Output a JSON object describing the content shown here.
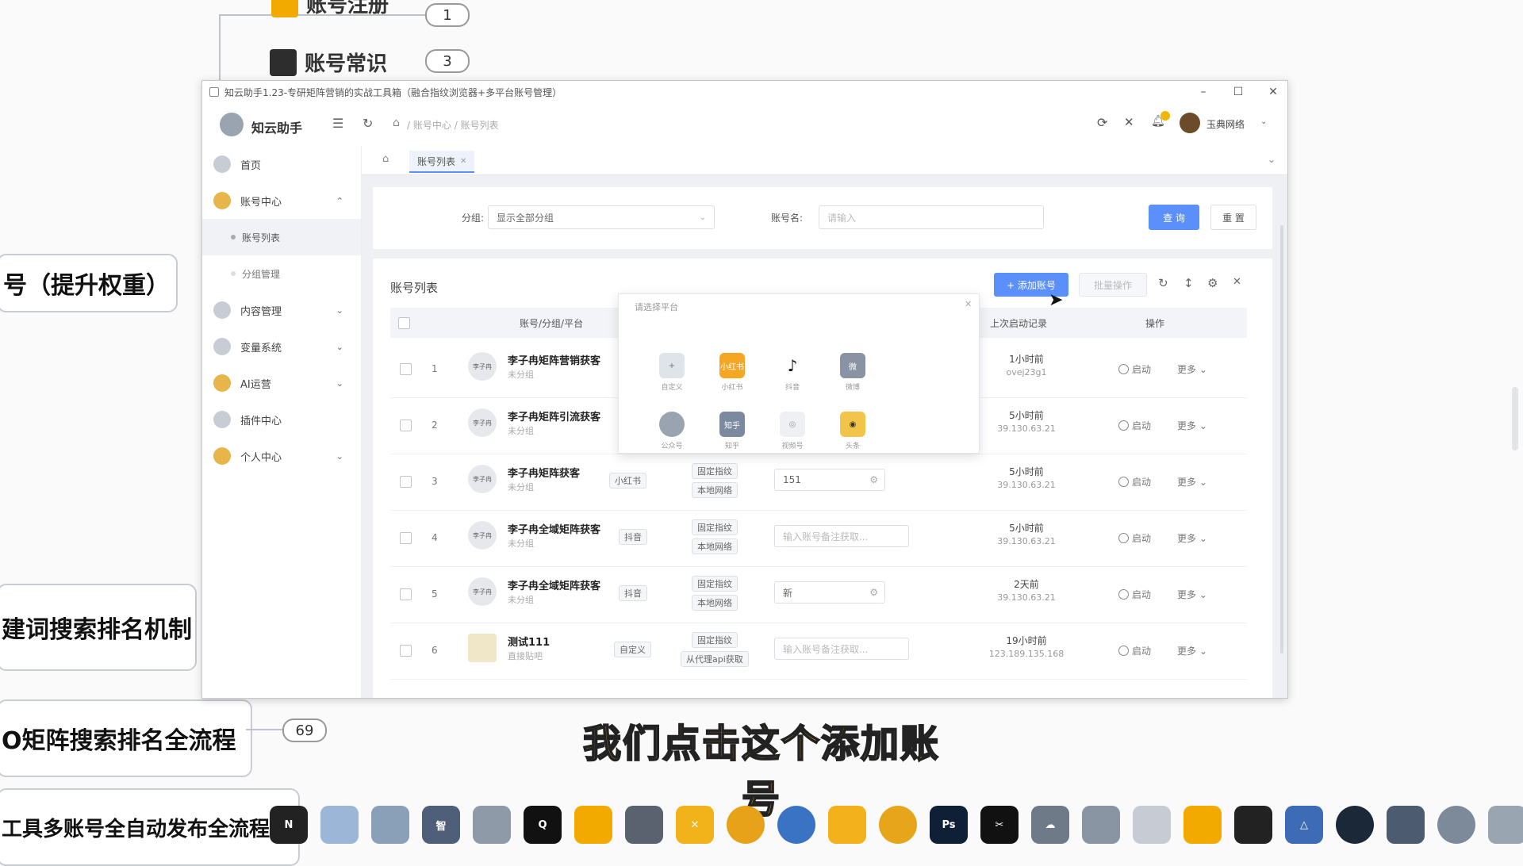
{
  "mindmap": {
    "top_node": "账号注册",
    "node_accounts": "账号常识",
    "badge_1": "1",
    "badge_3": "3",
    "node_weight": "号（提升权重）",
    "node_keyword": "建词搜索排名机制",
    "node_process": "O矩阵搜索排名全流程",
    "badge_69": "69",
    "node_tools": "工具多账号全自动发布全流程演示"
  },
  "window": {
    "title": "知云助手1.23-专研矩阵营销的实战工具箱（融合指纹浏览器+多平台账号管理）",
    "app_name": "知云助手",
    "breadcrumb": [
      "账号中心",
      "账号列表"
    ],
    "user": "玉典网络"
  },
  "sidebar": {
    "items": [
      {
        "label": "首页"
      },
      {
        "label": "账号中心"
      },
      {
        "label": "内容管理"
      },
      {
        "label": "变量系统"
      },
      {
        "label": "AI运营"
      },
      {
        "label": "插件中心"
      },
      {
        "label": "个人中心"
      }
    ],
    "sub_items": [
      {
        "label": "账号列表"
      },
      {
        "label": "分组管理"
      }
    ]
  },
  "tabs": {
    "active": "账号列表"
  },
  "filter": {
    "group_label": "分组:",
    "group_value": "显示全部分组",
    "name_label": "账号名:",
    "name_placeholder": "请输入",
    "search_btn": "查 询",
    "reset_btn": "重 置"
  },
  "list": {
    "title": "账号列表",
    "add_btn": "+ 添加账号",
    "batch_btn": "批量操作",
    "headers": {
      "account": "账号/分组/平台",
      "last_start": "上次启动记录",
      "ops": "操作"
    },
    "start_label": "启动",
    "more_label": "更多",
    "rows": [
      {
        "idx": "1",
        "name": "李子冉矩阵营销获客",
        "group": "未分组",
        "platform": "",
        "tag1": "",
        "tag2": "",
        "remark": "",
        "time": "1小时前",
        "ip": "ovej23g1"
      },
      {
        "idx": "2",
        "name": "李子冉矩阵引流获客",
        "group": "未分组",
        "platform": "",
        "tag1": "",
        "tag2": "",
        "remark": "",
        "time": "5小时前",
        "ip": "39.130.63.21"
      },
      {
        "idx": "3",
        "name": "李子冉矩阵获客",
        "group": "未分组",
        "platform": "小红书",
        "tag1": "固定指纹",
        "tag2": "本地网络",
        "remark": "151",
        "time": "5小时前",
        "ip": "39.130.63.21"
      },
      {
        "idx": "4",
        "name": "李子冉全域矩阵获客",
        "group": "未分组",
        "platform": "抖音",
        "tag1": "固定指纹",
        "tag2": "本地网络",
        "remark": "输入账号备注获取...",
        "time": "5小时前",
        "ip": "39.130.63.21"
      },
      {
        "idx": "5",
        "name": "李子冉全域矩阵获客",
        "group": "未分组",
        "platform": "抖音",
        "tag1": "固定指纹",
        "tag2": "本地网络",
        "remark": "新",
        "time": "2天前",
        "ip": "39.130.63.21"
      },
      {
        "idx": "6",
        "name": "测试111",
        "group": "直接贴吧",
        "platform": "自定义",
        "tag1": "固定指纹",
        "tag2": "从代理api获取",
        "remark": "输入账号备注获取...",
        "time": "19小时前",
        "ip": "123.189.135.168"
      }
    ]
  },
  "popup": {
    "title": "请选择平台",
    "platforms_row1": [
      {
        "label": "自定义",
        "icon": "custom-icon",
        "color": "#dfe3ea"
      },
      {
        "label": "小红书",
        "icon": "xiaohongshu-icon",
        "color": "#f5a623"
      },
      {
        "label": "抖音",
        "icon": "douyin-icon",
        "color": "#ffffff"
      },
      {
        "label": "微博",
        "icon": "weibo-icon",
        "color": "#8a93a3"
      }
    ],
    "platforms_row2": [
      {
        "label": "公众号",
        "icon": "wechat-mp-icon",
        "color": "#9aa3b0"
      },
      {
        "label": "知乎",
        "icon": "zhihu-icon",
        "color": "#7c8aa0"
      },
      {
        "label": "视频号",
        "icon": "channels-icon",
        "color": "#eef0f3"
      },
      {
        "label": "头条",
        "icon": "toutiao-icon",
        "color": "#f3c44a"
      }
    ]
  },
  "caption": "我们点击这个添加账号",
  "taskbar": {
    "icons": [
      "nexus-icon",
      "folder-icon",
      "robot-icon",
      "zhi-icon",
      "wechat-icon",
      "qq-icon",
      "capture-icon",
      "app-icon",
      "x-icon",
      "map-icon",
      "edge-icon",
      "tv-icon",
      "chart-icon",
      "ps-icon",
      "capcut-icon",
      "cloud-icon",
      "cluster-icon",
      "avatar-icon",
      "shield-icon",
      "app2-icon",
      "mountain-icon",
      "steam-icon",
      "pin-icon",
      "search-icon",
      "window-icon"
    ]
  }
}
